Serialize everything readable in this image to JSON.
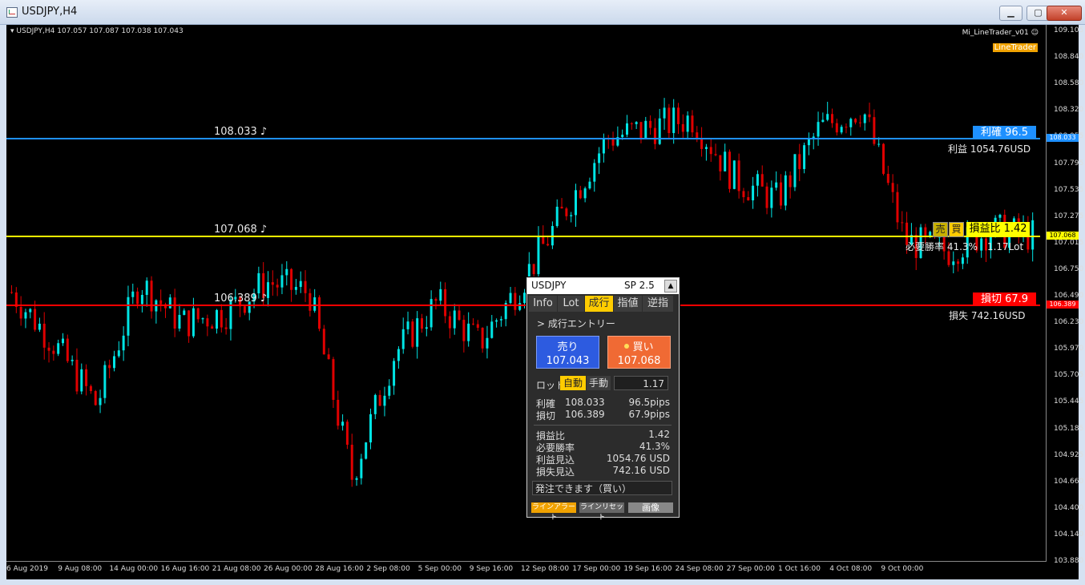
{
  "window": {
    "title": "USDJPY,H4"
  },
  "chart": {
    "header": "USDJPY,H4  107.057 107.087 107.038 107.043",
    "ea_name": "Mi_LineTrader_v01 ☺",
    "badge": "LineTrader",
    "y_ticks": [
      "109.105",
      "108.840",
      "108.580",
      "108.320",
      "108.055",
      "107.795",
      "107.535",
      "107.275",
      "107.015",
      "106.750",
      "106.490",
      "106.230",
      "105.970",
      "105.705",
      "105.445",
      "105.185",
      "104.925",
      "104.660",
      "104.400",
      "104.140",
      "103.880"
    ],
    "x_ticks": [
      "6 Aug 2019",
      "9 Aug 08:00",
      "14 Aug 00:00",
      "16 Aug 16:00",
      "21 Aug 08:00",
      "26 Aug 00:00",
      "28 Aug 16:00",
      "2 Sep 08:00",
      "5 Sep 00:00",
      "9 Sep 16:00",
      "12 Sep 08:00",
      "17 Sep 00:00",
      "19 Sep 16:00",
      "24 Sep 08:00",
      "27 Sep 00:00",
      "1 Oct 16:00",
      "4 Oct 08:00",
      "9 Oct 00:00"
    ],
    "tp": {
      "level": "108.033 ♪",
      "tag": "108.033",
      "label": "利確 96.5",
      "profit": "利益 1054.76USD",
      "color": "#1e90ff"
    },
    "entry": {
      "level": "107.068 ♪",
      "tag": "107.068",
      "sell": "売",
      "buy": "買",
      "rr": "損益比 1.42",
      "winrate": "必要勝率 41.3%　1.17Lot",
      "color": "#ffff00"
    },
    "sl": {
      "level": "106.389 ♪",
      "tag": "106.389",
      "label": "損切 67.9",
      "loss": "損失 742.16USD",
      "color": "#ff0000"
    }
  },
  "panel": {
    "symbol": "USDJPY",
    "spread": "SP 2.5",
    "collapse": "▲",
    "tabs": [
      "Info",
      "Lot",
      "成行",
      "指値",
      "逆指"
    ],
    "subtitle": "> 成行エントリー",
    "sell_label": "売り",
    "sell_price": "107.043",
    "buy_label": "買い",
    "buy_price": "107.068",
    "lot_label": "ロット",
    "auto": "自動",
    "manual": "手動",
    "lot_value": "1.17",
    "tp_label": "利確",
    "tp_price": "108.033",
    "tp_pips": "96.5pips",
    "sl_label": "損切",
    "sl_price": "106.389",
    "sl_pips": "67.9pips",
    "rr_label": "損益比",
    "rr_value": "1.42",
    "win_label": "必要勝率",
    "win_value": "41.3%",
    "profit_label": "利益見込",
    "profit_value": "1054.76 USD",
    "loss_label": "損失見込",
    "loss_value": "742.16 USD",
    "status": "発注できます（買い）",
    "btn_alert": "ラインアラート",
    "btn_reset": "ラインリセット",
    "btn_image": "画像"
  },
  "chart_data": {
    "type": "candlestick",
    "symbol": "USDJPY",
    "timeframe": "H4",
    "ylim": [
      103.88,
      109.105
    ],
    "up_color": "#00e5e5",
    "down_color": "#e00000",
    "x": [
      "6 Aug 2019",
      "9 Aug 08:00",
      "14 Aug 00:00",
      "16 Aug 16:00",
      "21 Aug 08:00",
      "26 Aug 00:00",
      "28 Aug 16:00",
      "2 Sep 08:00",
      "5 Sep 00:00",
      "9 Sep 16:00",
      "12 Sep 08:00",
      "17 Sep 00:00",
      "19 Sep 16:00",
      "24 Sep 08:00",
      "27 Sep 00:00",
      "1 Oct 16:00",
      "4 Oct 08:00",
      "9 Oct 00:00"
    ],
    "close_path": [
      106.5,
      106.0,
      105.4,
      106.6,
      106.2,
      106.3,
      106.6,
      106.5,
      104.7,
      105.9,
      106.4,
      106.0,
      106.6,
      107.3,
      108.0,
      108.1,
      108.2,
      107.6,
      107.4,
      108.1,
      108.3,
      107.0,
      106.9,
      107.1,
      107.05
    ],
    "lines": {
      "tp": 108.033,
      "entry": 107.068,
      "sl": 106.389
    }
  }
}
